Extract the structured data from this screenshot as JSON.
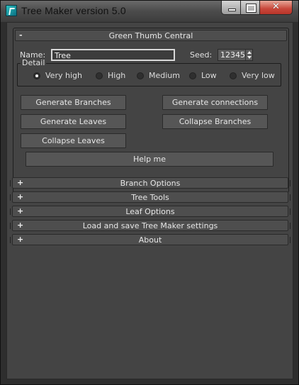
{
  "window": {
    "title": "Tree Maker version 5.0",
    "icon": "3ds-max-icon",
    "controls": {
      "minimize": "minimize-icon",
      "maximize": "maximize-icon",
      "close": "✕"
    }
  },
  "main_rollout": {
    "sign": "-",
    "title": "Green Thumb Central",
    "name_label": "Name:",
    "name_value": "Tree",
    "seed_label": "Seed:",
    "seed_value": "12345",
    "detail": {
      "title": "Detail",
      "options": [
        "Very high",
        "High",
        "Medium",
        "Low",
        "Very low"
      ],
      "selected": "Very high"
    },
    "buttons": {
      "generate_branches": "Generate Branches",
      "generate_connections": "Generate connections",
      "generate_leaves": "Generate Leaves",
      "collapse_branches": "Collapse Branches",
      "collapse_leaves": "Collapse Leaves",
      "help": "Help me"
    }
  },
  "rollouts": [
    {
      "sign": "+",
      "title": "Branch Options"
    },
    {
      "sign": "+",
      "title": "Tree Tools"
    },
    {
      "sign": "+",
      "title": "Leaf Options"
    },
    {
      "sign": "+",
      "title": "Load and save Tree Maker settings"
    },
    {
      "sign": "+",
      "title": "About"
    }
  ],
  "colors": {
    "panel": "#444444",
    "button": "#565656",
    "titlebar": "#4b4b4b",
    "close_button": "#c8473a"
  }
}
